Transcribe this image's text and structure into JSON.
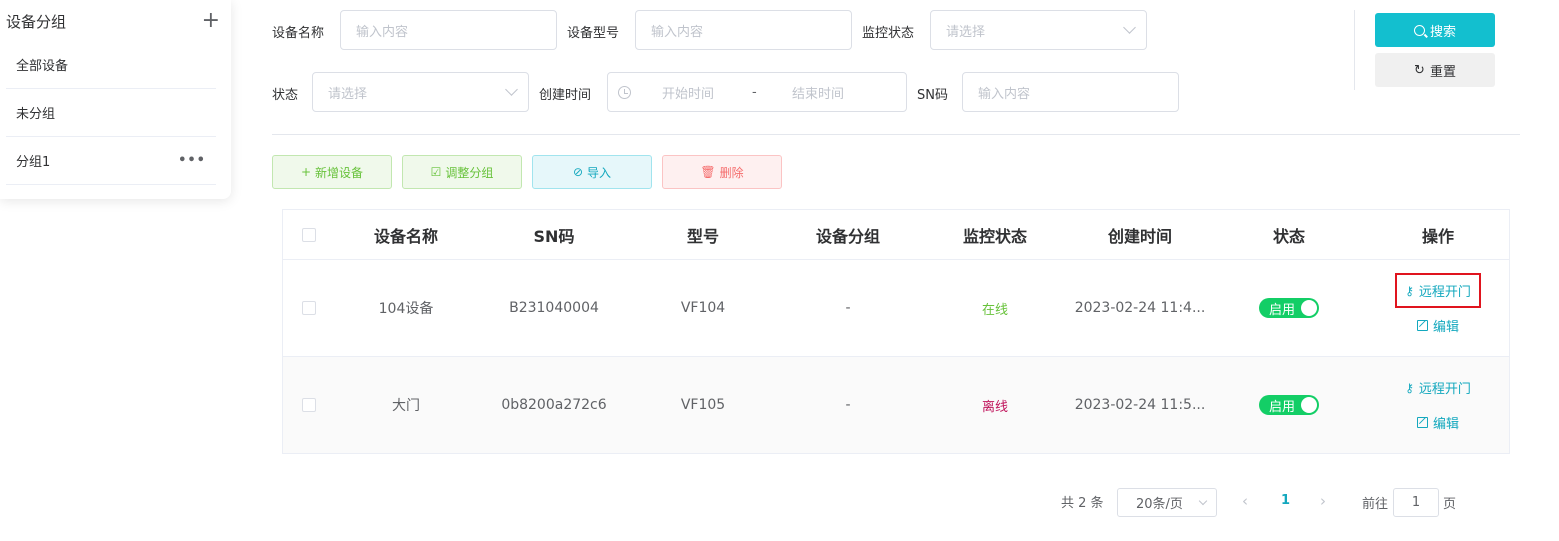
{
  "sidebar": {
    "title": "设备分组",
    "add_icon": "plus-icon",
    "items": [
      {
        "label": "全部设备"
      },
      {
        "label": "未分组"
      },
      {
        "label": "分组1",
        "more": "•••"
      }
    ]
  },
  "filters": {
    "device_name_label": "设备名称",
    "device_name_placeholder": "输入内容",
    "device_model_label": "设备型号",
    "device_model_placeholder": "输入内容",
    "monitor_status_label": "监控状态",
    "monitor_status_placeholder": "请选择",
    "status_label": "状态",
    "status_placeholder": "请选择",
    "created_time_label": "创建时间",
    "start_placeholder": "开始时间",
    "range_separator": "-",
    "end_placeholder": "结束时间",
    "sn_label": "SN码",
    "sn_placeholder": "输入内容"
  },
  "buttons": {
    "search": "搜索",
    "reset": "重置",
    "add_device": "新增设备",
    "adjust_group": "调整分组",
    "import": "导入",
    "delete": "删除"
  },
  "table": {
    "columns": [
      "设备名称",
      "SN码",
      "型号",
      "设备分组",
      "监控状态",
      "创建时间",
      "状态",
      "操作"
    ],
    "rows": [
      {
        "name": "104设备",
        "sn": "B231040004",
        "model": "VF104",
        "group": "-",
        "monitor": "在线",
        "created": "2023-02-24 11:4...",
        "status": "启用",
        "op_remote": "远程开门",
        "op_edit": "编辑"
      },
      {
        "name": "大门",
        "sn": "0b8200a272c6",
        "model": "VF105",
        "group": "-",
        "monitor": "离线",
        "created": "2023-02-24 11:5...",
        "status": "启用",
        "op_remote": "远程开门",
        "op_edit": "编辑"
      }
    ]
  },
  "pagination": {
    "total": "共 2 条",
    "page_size": "20条/页",
    "prev": "‹",
    "current": "1",
    "next": "›",
    "goto_label": "前往",
    "goto_value": "1",
    "page_suffix": "页"
  },
  "colors": {
    "accent": "#13bfcf",
    "online": "#67c23a",
    "offline": "#c0135b",
    "highlight_box": "#e0141e"
  }
}
